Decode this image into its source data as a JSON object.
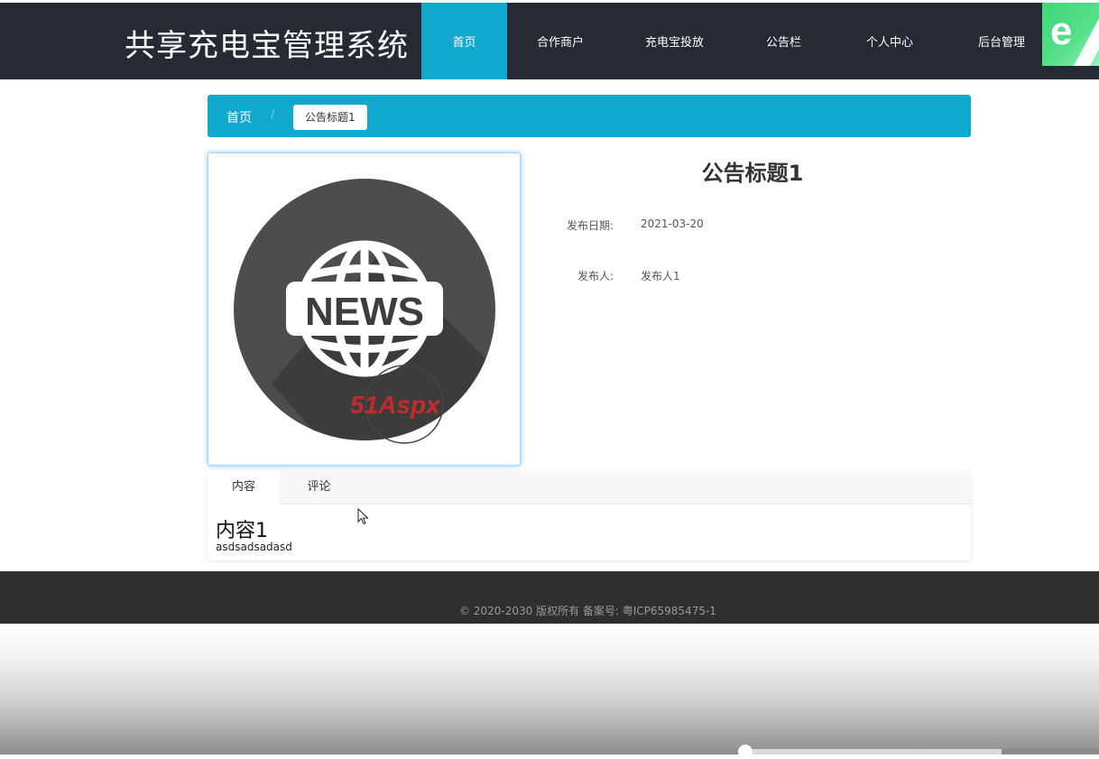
{
  "header": {
    "site_title": "共享充电宝管理系统",
    "nav": [
      {
        "label": "首页",
        "active": true
      },
      {
        "label": "合作商户",
        "active": false
      },
      {
        "label": "充电宝投放",
        "active": false
      },
      {
        "label": "公告栏",
        "active": false
      },
      {
        "label": "个人中心",
        "active": false
      },
      {
        "label": "后台管理",
        "active": false
      }
    ],
    "accent_color": "#11a8cd",
    "logo_icon": "e-browser-icon"
  },
  "breadcrumb": {
    "home": "首页",
    "separator": "/",
    "current": "公告标题1"
  },
  "notice": {
    "image_icon": "news-globe-image",
    "image_text": "NEWS",
    "watermark_text": "51Aspx",
    "title": "公告标题1",
    "date_label": "发布日期:",
    "date_value": "2021-03-20",
    "publisher_label": "发布人:",
    "publisher_value": "发布人1"
  },
  "tabs": [
    {
      "label": "内容",
      "active": true
    },
    {
      "label": "评论",
      "active": false
    }
  ],
  "content": {
    "heading": "内容1",
    "body": "asdsadsadasd"
  },
  "footer": {
    "copyright": "© 2020-2030 版权所有 备案号: 粤ICP65985475-1"
  }
}
